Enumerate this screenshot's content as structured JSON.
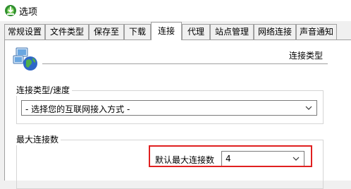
{
  "window": {
    "title": "选项",
    "icon": "download-manager-icon"
  },
  "tabs": [
    {
      "label": "常规设置"
    },
    {
      "label": "文件类型"
    },
    {
      "label": "保存至"
    },
    {
      "label": "下载"
    },
    {
      "label": "连接",
      "active": true
    },
    {
      "label": "代理"
    },
    {
      "label": "站点管理"
    },
    {
      "label": "网络连接"
    },
    {
      "label": "声音通知"
    }
  ],
  "connection": {
    "header_icon": "network-globe-icon",
    "section_title": "连接类型",
    "type_group": {
      "label": "连接类型/速度",
      "selected": "- 选择您的互联网接入方式 -"
    },
    "max_group": {
      "label": "最大连接数",
      "default_label": "默认最大连接数",
      "default_value": "4"
    }
  },
  "colors": {
    "highlight": "#e02020"
  }
}
